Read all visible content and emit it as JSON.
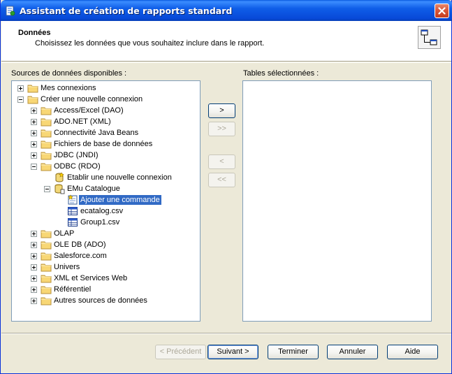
{
  "window": {
    "title": "Assistant de création de rapports standard"
  },
  "header": {
    "title": "Données",
    "subtitle": "Choisissez les données que vous souhaitez inclure dans le rapport."
  },
  "sources": {
    "label": "Sources de données disponibles :",
    "tree": [
      {
        "label": "Mes connexions",
        "level": 0,
        "expander": "plus",
        "icon": "folder-icon"
      },
      {
        "label": "Créer une nouvelle connexion",
        "level": 0,
        "expander": "minus",
        "icon": "folder-icon"
      },
      {
        "label": "Access/Excel (DAO)",
        "level": 1,
        "expander": "plus",
        "icon": "folder-icon"
      },
      {
        "label": "ADO.NET (XML)",
        "level": 1,
        "expander": "plus",
        "icon": "folder-icon"
      },
      {
        "label": "Connectivité Java Beans",
        "level": 1,
        "expander": "plus",
        "icon": "folder-icon"
      },
      {
        "label": "Fichiers de base de données",
        "level": 1,
        "expander": "plus",
        "icon": "folder-icon"
      },
      {
        "label": "JDBC (JNDI)",
        "level": 1,
        "expander": "plus",
        "icon": "folder-icon"
      },
      {
        "label": "ODBC (RDO)",
        "level": 1,
        "expander": "minus",
        "icon": "folder-icon"
      },
      {
        "label": "Etablir une nouvelle connexion",
        "level": 2,
        "expander": "none",
        "icon": "new-connection-icon"
      },
      {
        "label": "EMu Catalogue",
        "level": 2,
        "expander": "minus",
        "icon": "database-icon"
      },
      {
        "label": "Ajouter une commande",
        "level": 3,
        "expander": "none",
        "icon": "add-command-icon",
        "selected": true
      },
      {
        "label": "ecatalog.csv",
        "level": 3,
        "expander": "none",
        "icon": "table-icon"
      },
      {
        "label": "Group1.csv",
        "level": 3,
        "expander": "none",
        "icon": "table-icon"
      },
      {
        "label": "OLAP",
        "level": 1,
        "expander": "plus",
        "icon": "folder-icon"
      },
      {
        "label": "OLE DB (ADO)",
        "level": 1,
        "expander": "plus",
        "icon": "folder-icon"
      },
      {
        "label": "Salesforce.com",
        "level": 1,
        "expander": "plus",
        "icon": "folder-icon"
      },
      {
        "label": "Univers",
        "level": 1,
        "expander": "plus",
        "icon": "folder-icon"
      },
      {
        "label": "XML et Services Web",
        "level": 1,
        "expander": "plus",
        "icon": "folder-icon"
      },
      {
        "label": "Référentiel",
        "level": 1,
        "expander": "plus",
        "icon": "folder-icon"
      },
      {
        "label": "Autres sources de données",
        "level": 1,
        "expander": "plus",
        "icon": "folder-icon"
      }
    ]
  },
  "selected_tables": {
    "label": "Tables sélectionnées :"
  },
  "transfer": {
    "add": ">",
    "add_all": ">>",
    "remove": "<",
    "remove_all": "<<"
  },
  "footer": {
    "back": "< Précédent",
    "next": "Suivant >",
    "finish": "Terminer",
    "cancel": "Annuler",
    "help": "Aide"
  },
  "colors": {
    "selection": "#316ac5",
    "titlebar": "#0a5ae0",
    "window_bg": "#ece9d8",
    "close_button": "#d9573a"
  }
}
